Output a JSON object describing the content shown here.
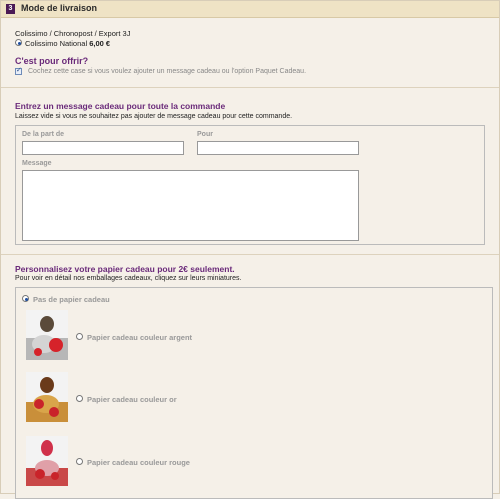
{
  "header": {
    "step": "3",
    "title": "Mode de livraison"
  },
  "shipping": {
    "carrier_label": "Colissimo / Chronopost / Export 3J",
    "option_name": "Colissimo National",
    "option_price": "6,00 €"
  },
  "gift": {
    "title": "C'est pour offrir?",
    "checkbox_text": "Cochez cette case si vous voulez ajouter un message cadeau ou l'option Paquet Cadeau."
  },
  "message": {
    "title": "Entrez un message cadeau pour toute la commande",
    "description": "Laissez vide si vous ne souhaitez pas ajouter de message cadeau pour cette commande.",
    "from_label": "De la part de",
    "to_label": "Pour",
    "message_label": "Message",
    "from_value": "",
    "to_value": "",
    "message_value": ""
  },
  "paper": {
    "title": "Personnalisez votre papier cadeau pour 2€ seulement.",
    "description": "Pour voir en détail nos emballages cadeaux, cliquez sur leurs miniatures.",
    "options": [
      {
        "label": "Pas de papier cadeau",
        "selected": true
      },
      {
        "label": "Papier cadeau couleur argent",
        "selected": false
      },
      {
        "label": "Papier cadeau couleur or",
        "selected": false
      },
      {
        "label": "Papier cadeau couleur rouge",
        "selected": false
      }
    ]
  },
  "colors": {
    "accent": "#6a2a7a",
    "step_badge": "#4b1a55",
    "background": "#f5f0e8"
  }
}
